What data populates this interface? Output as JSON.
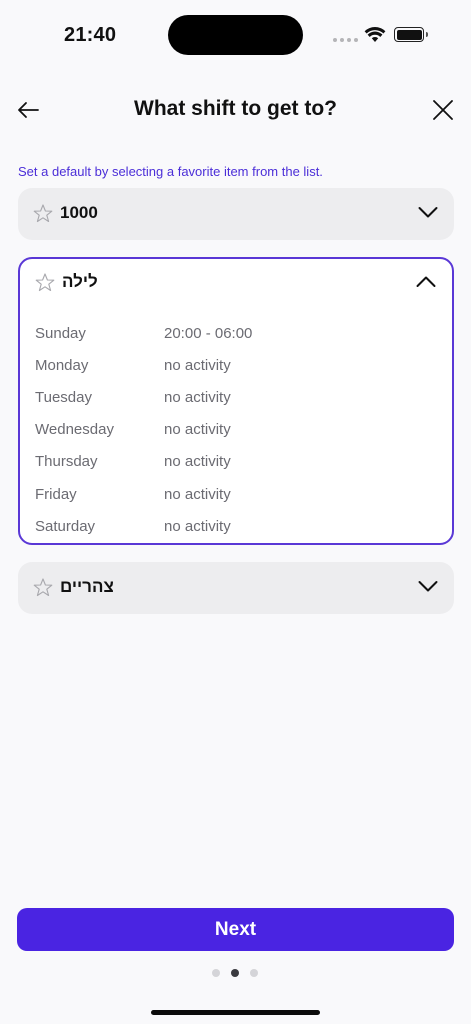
{
  "status": {
    "time": "21:40"
  },
  "header": {
    "title": "What shift to get to?"
  },
  "hint": "Set a default by selecting a favorite item from the list.",
  "cards": [
    {
      "label": "1000",
      "expanded": false
    },
    {
      "label": "לילה",
      "expanded": true,
      "schedule": [
        {
          "day": "Sunday",
          "value": "20:00 - 06:00"
        },
        {
          "day": "Monday",
          "value": "no activity"
        },
        {
          "day": "Tuesday",
          "value": "no activity"
        },
        {
          "day": "Wednesday",
          "value": "no activity"
        },
        {
          "day": "Thursday",
          "value": "no activity"
        },
        {
          "day": "Friday",
          "value": "no activity"
        },
        {
          "day": "Saturday",
          "value": "no activity"
        }
      ]
    },
    {
      "label": "צהריים",
      "expanded": false
    }
  ],
  "footer": {
    "next_label": "Next",
    "page_indicator": {
      "total": 3,
      "current": 2
    }
  },
  "colors": {
    "accent": "#4a24e2",
    "accent_border": "#5a38d6",
    "hint": "#4b2ed8",
    "card_bg": "#ededef"
  }
}
